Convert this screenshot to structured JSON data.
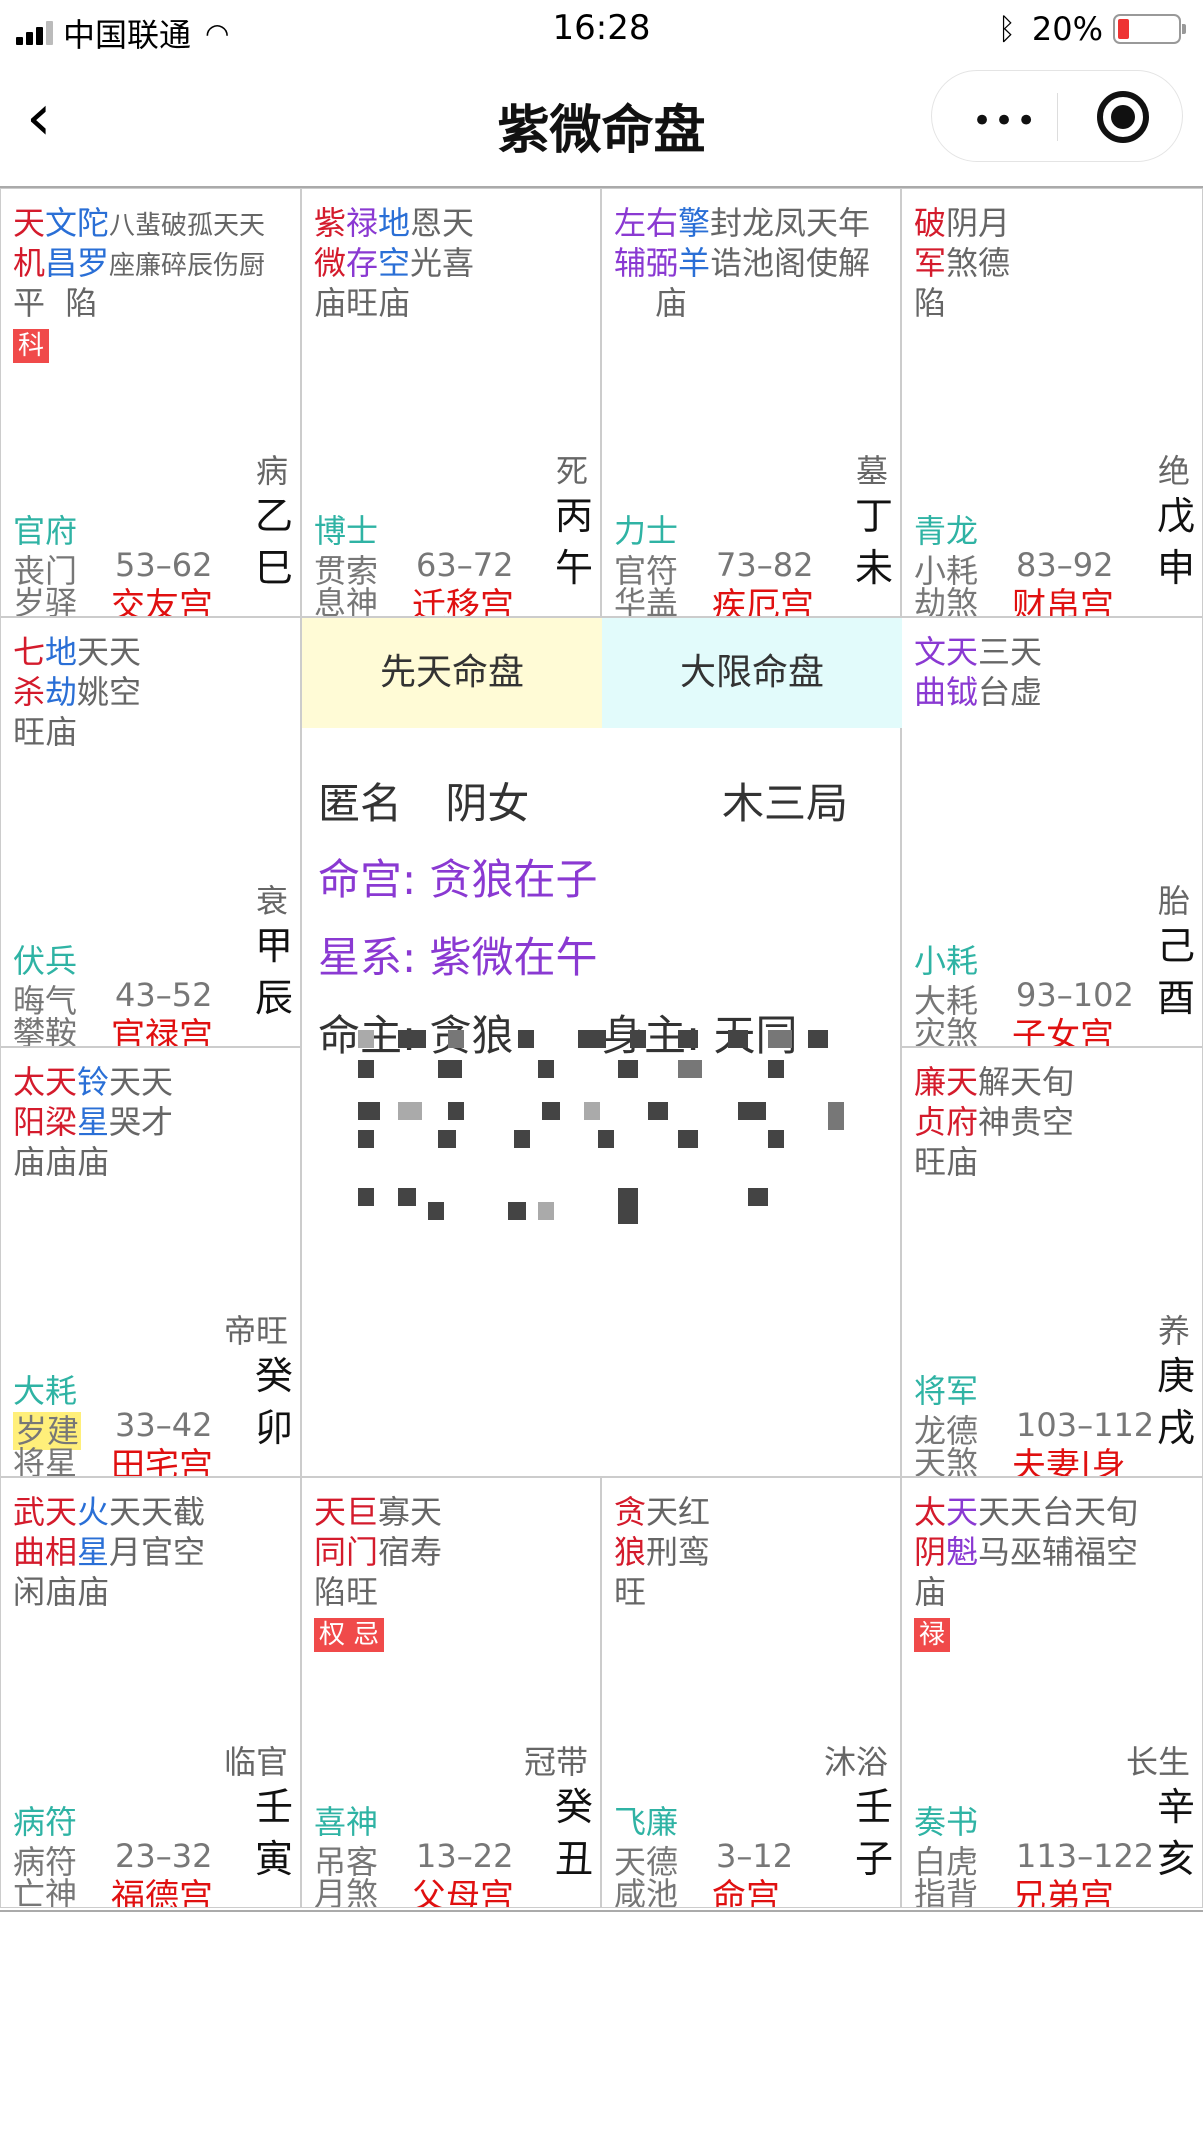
{
  "status_bar": {
    "carrier": "中国联通",
    "time": "16:28",
    "battery": "20%"
  },
  "nav": {
    "back": "‹",
    "title": "紫微命盘",
    "more": "•••"
  },
  "center": {
    "tab1": "先天命盘",
    "tab2": "大限命盘",
    "line1_name": "匿名",
    "line1_gender": "阴女",
    "line1_ju": "木三局",
    "line2": "命宫: 贪狼在子",
    "line3": "星系: 紫微在午",
    "line4_a": "命主: 贪狼",
    "line4_b": "身主: 天同"
  },
  "palaces": [
    {
      "id": "si",
      "half": 0,
      "lines": [
        [
          {
            "t": "天",
            "c": "red"
          },
          {
            "t": "文",
            "c": "blue"
          },
          {
            "t": "陀",
            "c": "blue"
          },
          {
            "t": "八蜚破孤天天",
            "c": "gray",
            "small": true
          }
        ],
        [
          {
            "t": "机",
            "c": "red"
          },
          {
            "t": "昌",
            "c": "blue"
          },
          {
            "t": "罗",
            "c": "blue"
          },
          {
            "t": "座廉碎辰伤厨",
            "c": "gray",
            "small": true
          }
        ],
        [
          {
            "t": "平  陷",
            "c": "gray"
          }
        ]
      ],
      "badge": "科",
      "phase": "病",
      "dstar": "官府",
      "b1": "丧门",
      "b2": "岁驿",
      "age": "53–62",
      "name": "交友宫",
      "gz1": "乙",
      "gz2": "巳"
    },
    {
      "id": "wu",
      "half": 1,
      "lines": [
        [
          {
            "t": "紫",
            "c": "red"
          },
          {
            "t": "禄",
            "c": "purple"
          },
          {
            "t": "地",
            "c": "blue"
          },
          {
            "t": "恩天",
            "c": "gray"
          }
        ],
        [
          {
            "t": "微",
            "c": "red"
          },
          {
            "t": "存",
            "c": "purple"
          },
          {
            "t": "空",
            "c": "blue"
          },
          {
            "t": "光喜",
            "c": "gray"
          }
        ],
        [
          {
            "t": "庙旺庙",
            "c": "gray"
          }
        ]
      ],
      "badge": "",
      "phase": "死",
      "dstar": "博士",
      "b1": "贯索",
      "b2": "息神",
      "age": "63–72",
      "name": "迁移宫",
      "gz1": "丙",
      "gz2": "午"
    },
    {
      "id": "wei",
      "half": 0,
      "lines": [
        [
          {
            "t": "左",
            "c": "purple"
          },
          {
            "t": "右",
            "c": "purple"
          },
          {
            "t": "擎",
            "c": "blue"
          },
          {
            "t": "封龙凤天年",
            "c": "gray"
          }
        ],
        [
          {
            "t": "辅",
            "c": "purple"
          },
          {
            "t": "弼",
            "c": "purple"
          },
          {
            "t": "羊",
            "c": "blue"
          },
          {
            "t": "诰池阁使解",
            "c": "gray"
          }
        ],
        [
          {
            "t": "    庙",
            "c": "gray"
          }
        ]
      ],
      "badge": "",
      "phase": "墓",
      "dstar": "力士",
      "b1": "官符",
      "b2": "华盖",
      "age": "73–82",
      "name": "疾厄宫",
      "gz1": "丁",
      "gz2": "未"
    },
    {
      "id": "shen",
      "half": 1,
      "lines": [
        [
          {
            "t": "破",
            "c": "red"
          },
          {
            "t": "阴月",
            "c": "gray"
          }
        ],
        [
          {
            "t": "军",
            "c": "red"
          },
          {
            "t": "煞德",
            "c": "gray"
          }
        ],
        [
          {
            "t": "陷",
            "c": "gray"
          }
        ]
      ],
      "badge": "",
      "phase": "绝",
      "dstar": "青龙",
      "b1": "小耗",
      "b2": "劫煞",
      "age": "83–92",
      "name": "财帛宫",
      "gz1": "戊",
      "gz2": "申"
    },
    {
      "id": "chen",
      "half": 0,
      "lines": [
        [
          {
            "t": "七",
            "c": "red"
          },
          {
            "t": "地",
            "c": "blue"
          },
          {
            "t": "天天",
            "c": "gray"
          }
        ],
        [
          {
            "t": "杀",
            "c": "red"
          },
          {
            "t": "劫",
            "c": "blue"
          },
          {
            "t": "姚空",
            "c": "gray"
          }
        ],
        [
          {
            "t": "旺庙",
            "c": "gray"
          }
        ]
      ],
      "badge": "",
      "phase": "衰",
      "dstar": "伏兵",
      "b1": "晦气",
      "b2": "攀鞍",
      "age": "43–52",
      "name": "官禄宫",
      "gz1": "甲",
      "gz2": "辰"
    },
    {
      "id": "you",
      "half": 0,
      "lines": [
        [
          {
            "t": "文",
            "c": "purple"
          },
          {
            "t": "天",
            "c": "purple"
          },
          {
            "t": "三天",
            "c": "gray"
          }
        ],
        [
          {
            "t": "曲",
            "c": "purple"
          },
          {
            "t": "钺",
            "c": "purple"
          },
          {
            "t": "台虚",
            "c": "gray"
          }
        ]
      ],
      "badge": "",
      "phase": "胎",
      "dstar": "小耗",
      "b1": "大耗",
      "b2": "灾煞",
      "age": "93–102",
      "name": "子女宫",
      "gz1": "己",
      "gz2": "酉"
    },
    {
      "id": "mao",
      "half": 0,
      "lines": [
        [
          {
            "t": "太",
            "c": "red"
          },
          {
            "t": "天",
            "c": "red"
          },
          {
            "t": "铃",
            "c": "blue"
          },
          {
            "t": "天天",
            "c": "gray"
          }
        ],
        [
          {
            "t": "阳",
            "c": "red"
          },
          {
            "t": "梁",
            "c": "red"
          },
          {
            "t": "星",
            "c": "blue"
          },
          {
            "t": "哭才",
            "c": "gray"
          }
        ],
        [
          {
            "t": "庙庙庙",
            "c": "gray"
          }
        ]
      ],
      "badge": "",
      "phase": "帝旺",
      "dstar": "大耗",
      "b1": "岁建",
      "b1hl": true,
      "b2": "将星",
      "age": "33–42",
      "name": "田宅宫",
      "gz1": "癸",
      "gz2": "卯"
    },
    {
      "id": "xu",
      "half": 0,
      "lines": [
        [
          {
            "t": "廉",
            "c": "red"
          },
          {
            "t": "天",
            "c": "red"
          },
          {
            "t": "解天旬",
            "c": "gray"
          }
        ],
        [
          {
            "t": "贞",
            "c": "red"
          },
          {
            "t": "府",
            "c": "red"
          },
          {
            "t": "神贵空",
            "c": "gray"
          }
        ],
        [
          {
            "t": "旺庙",
            "c": "gray"
          }
        ]
      ],
      "badge": "",
      "phase": "养",
      "dstar": "将军",
      "b1": "龙德",
      "b2": "天煞",
      "age": "103–112",
      "name": "夫妻|身",
      "gz1": "庚",
      "gz2": "戌"
    },
    {
      "id": "yin",
      "half": 0,
      "lines": [
        [
          {
            "t": "武",
            "c": "red"
          },
          {
            "t": "天",
            "c": "red"
          },
          {
            "t": "火",
            "c": "blue"
          },
          {
            "t": "天天截",
            "c": "gray"
          }
        ],
        [
          {
            "t": "曲",
            "c": "red"
          },
          {
            "t": "相",
            "c": "red"
          },
          {
            "t": "星",
            "c": "blue"
          },
          {
            "t": "月官空",
            "c": "gray"
          }
        ],
        [
          {
            "t": "闲庙庙",
            "c": "gray"
          }
        ]
      ],
      "badge": "",
      "phase": "临官",
      "dstar": "病符",
      "b1": "病符",
      "b2": "亡神",
      "age": "23–32",
      "name": "福德宫",
      "gz1": "壬",
      "gz2": "寅"
    },
    {
      "id": "chou",
      "half": 1,
      "lines": [
        [
          {
            "t": "天",
            "c": "red"
          },
          {
            "t": "巨",
            "c": "red"
          },
          {
            "t": "寡天",
            "c": "gray"
          }
        ],
        [
          {
            "t": "同",
            "c": "red"
          },
          {
            "t": "门",
            "c": "red"
          },
          {
            "t": "宿寿",
            "c": "gray"
          }
        ],
        [
          {
            "t": "陷旺",
            "c": "gray"
          }
        ]
      ],
      "badge": "权 忌",
      "phase": "冠带",
      "dstar": "喜神",
      "b1": "吊客",
      "b2": "月煞",
      "age": "13–22",
      "name": "父母宫",
      "gz1": "癸",
      "gz2": "丑"
    },
    {
      "id": "zi",
      "half": 0,
      "lines": [
        [
          {
            "t": "贪",
            "c": "red"
          },
          {
            "t": "天红",
            "c": "gray"
          }
        ],
        [
          {
            "t": "狼",
            "c": "red"
          },
          {
            "t": "刑鸾",
            "c": "gray"
          }
        ],
        [
          {
            "t": "旺",
            "c": "gray"
          }
        ]
      ],
      "badge": "",
      "phase": "沐浴",
      "dstar": "飞廉",
      "b1": "天德",
      "b2": "咸池",
      "age": "3–12",
      "name": "命宫",
      "gz1": "壬",
      "gz2": "子"
    },
    {
      "id": "hai",
      "half": 1,
      "lines": [
        [
          {
            "t": "太",
            "c": "red"
          },
          {
            "t": "天",
            "c": "purple"
          },
          {
            "t": "天天台天旬",
            "c": "gray"
          }
        ],
        [
          {
            "t": "阴",
            "c": "red"
          },
          {
            "t": "魁",
            "c": "purple"
          },
          {
            "t": "马巫辅福空",
            "c": "gray"
          }
        ],
        [
          {
            "t": "庙",
            "c": "gray"
          }
        ]
      ],
      "badge": "禄",
      "phase": "长生",
      "dstar": "奏书",
      "b1": "白虎",
      "b2": "指背",
      "age": "113–122",
      "name": "兄弟宫",
      "gz1": "辛",
      "gz2": "亥"
    }
  ]
}
